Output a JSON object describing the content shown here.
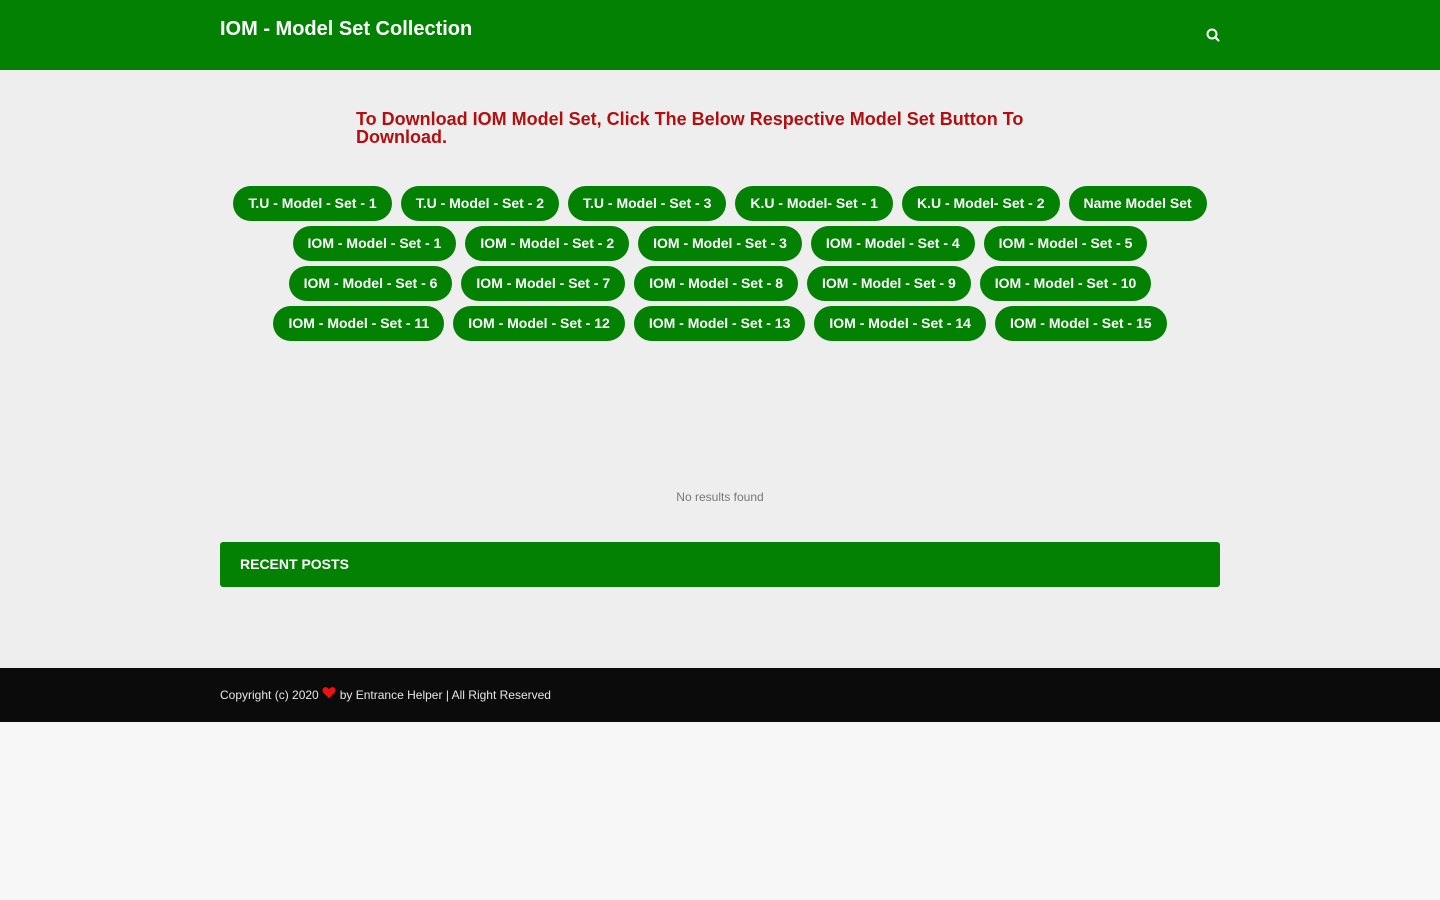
{
  "header": {
    "site_title": "IOM - Model Set Collection",
    "search_icon": "search-icon",
    "bg_color": "#028103"
  },
  "main": {
    "heading": "To Download IOM Model Set, Click The Below Respective Model Set Button To Download.",
    "heading_color": "#b21010",
    "button_rows": [
      [
        "T.U - Model - Set - 1",
        "T.U - Model - Set - 2",
        "T.U - Model - Set - 3",
        "K.U - Model- Set - 1",
        "K.U - Model- Set - 2",
        "Name Model Set"
      ],
      [
        "IOM - Model - Set - 1",
        "IOM - Model - Set - 2",
        "IOM - Model - Set - 3",
        "IOM - Model - Set - 4",
        "IOM - Model - Set - 5"
      ],
      [
        "IOM - Model - Set - 6",
        "IOM - Model - Set - 7",
        "IOM - Model - Set - 8",
        "IOM - Model - Set - 9",
        "IOM - Model - Set - 10"
      ],
      [
        "IOM - Model - Set - 11",
        "IOM - Model - Set - 12",
        "IOM - Model - Set - 13",
        "IOM - Model - Set - 14",
        "IOM - Model - Set - 15"
      ]
    ],
    "no_results": "No results found",
    "recent_posts_title": "RECENT POSTS"
  },
  "footer": {
    "copyright_prefix": "Copyright (c) 2020",
    "heart_icon": "heart-icon",
    "heart_color": "#ee1111",
    "by_text": "by",
    "author_link": "Entrance Helper",
    "rights": "| All Right Reserved"
  }
}
